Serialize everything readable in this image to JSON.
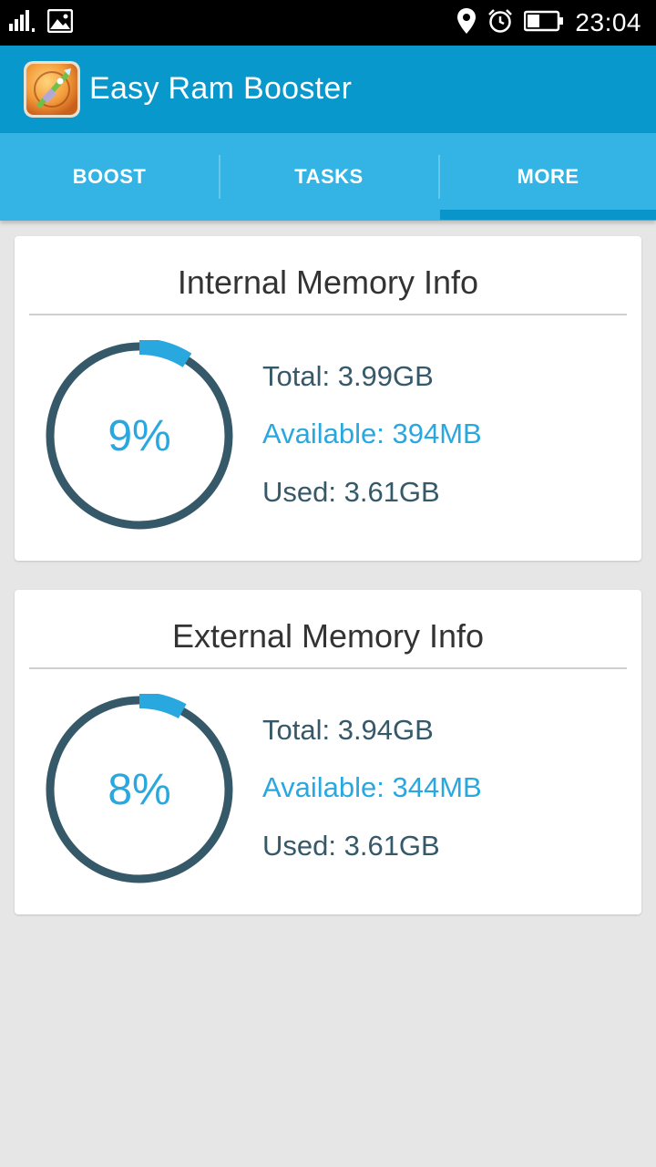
{
  "status_bar": {
    "time": "23:04",
    "icons": [
      "signal-icon",
      "image-notification-icon",
      "location-icon",
      "alarm-icon",
      "battery-icon"
    ]
  },
  "app": {
    "title": "Easy Ram Booster",
    "logo": "rocket-logo-icon"
  },
  "tabs": [
    {
      "label": "BOOST",
      "selected": false
    },
    {
      "label": "TASKS",
      "selected": false
    },
    {
      "label": "MORE",
      "selected": true
    }
  ],
  "cards": [
    {
      "title": "Internal Memory Info",
      "percent": 9,
      "percent_label": "9%",
      "total": "Total: 3.99GB",
      "available": "Available: 394MB",
      "used": "Used: 3.61GB"
    },
    {
      "title": "External Memory Info",
      "percent": 8,
      "percent_label": "8%",
      "total": "Total: 3.94GB",
      "available": "Available: 344MB",
      "used": "Used: 3.61GB"
    }
  ],
  "colors": {
    "app_bar": "#0998cc",
    "tab_bar": "#33b4e4",
    "tab_indicator": "#0995c9",
    "accent": "#29a8e0",
    "ring": "#36596a",
    "background": "#e6e6e6"
  }
}
